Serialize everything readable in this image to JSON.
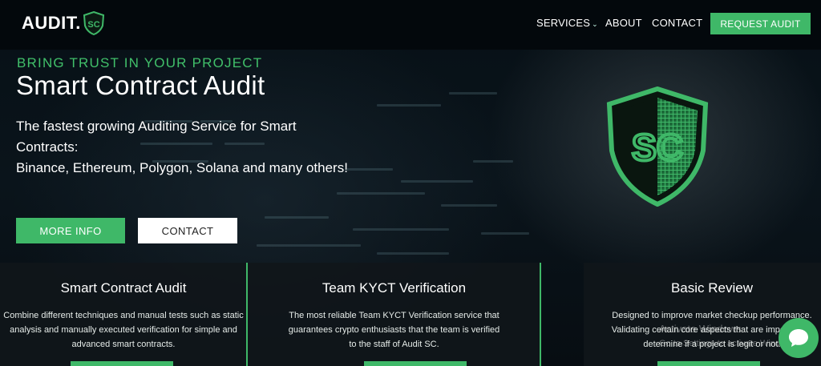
{
  "header": {
    "logo_text": "AUDIT.",
    "logo_badge_text": "SC",
    "nav": [
      {
        "label": "SERVICES",
        "has_dropdown": true
      },
      {
        "label": "ABOUT",
        "has_dropdown": false
      },
      {
        "label": "CONTACT",
        "has_dropdown": false
      }
    ],
    "cta_label": "REQUEST AUDIT"
  },
  "hero": {
    "tagline": "BRING TRUST IN YOUR PROJECT",
    "title": "Smart Contract Audit",
    "description_line1": "The fastest growing Auditing Service for Smart Contracts:",
    "description_line2": "Binance, Ethereum, Polygon, Solana and many others!",
    "more_info_label": "MORE INFO",
    "contact_label": "CONTACT",
    "shield_text": "SC"
  },
  "cards": [
    {
      "title": "Smart Contract Audit",
      "text": "Combine different techniques and manual tests such as static analysis and manually executed verification for simple and advanced smart contracts."
    },
    {
      "title": "Team KYCT Verification",
      "text": "The most reliable Team KYCT Verification service that guarantees crypto enthusiasts that the team is verified to the staff of Audit SC."
    },
    {
      "title": "Basic Review",
      "text": "Designed to improve market checkup performance. Validating certain core aspects that are important to determine if a project is legit or not."
    }
  ],
  "overlay": {
    "watermark_line1": "Activate Windows",
    "watermark_line2": "Go to Settings to activate Windows."
  },
  "colors": {
    "accent": "#3fb868",
    "background": "#050b10",
    "header": "#03080c"
  },
  "icons": {
    "chat": "chat-bubble-icon",
    "dropdown": "chevron-down-icon",
    "shield": "shield-logo-icon"
  }
}
